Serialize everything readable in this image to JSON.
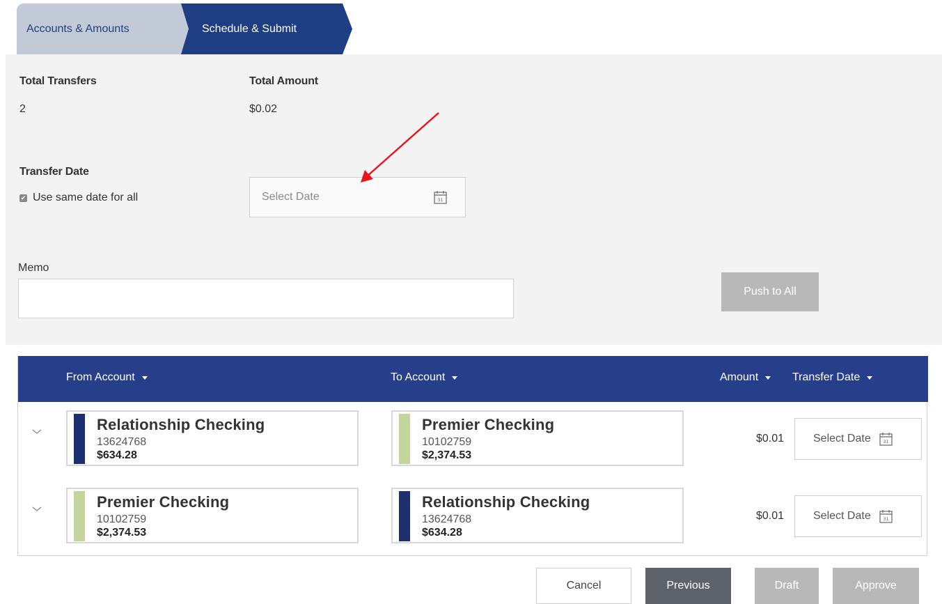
{
  "steps": [
    {
      "label": "Accounts & Amounts"
    },
    {
      "label": "Schedule & Submit"
    }
  ],
  "summary": {
    "total_transfers_label": "Total Transfers",
    "total_transfers_value": "2",
    "total_amount_label": "Total Amount",
    "total_amount_value": "$0.02",
    "transfer_date_label": "Transfer Date",
    "same_date_label": "Use same date for all",
    "same_date_checked": true,
    "date_placeholder": "Select Date",
    "memo_label": "Memo",
    "memo_value": "",
    "push_label": "Push to All"
  },
  "table": {
    "headers": {
      "from": "From Account",
      "to": "To Account",
      "amount": "Amount",
      "date": "Transfer Date"
    },
    "rows": [
      {
        "from": {
          "name": "Relationship Checking",
          "number": "13624768",
          "balance": "$634.28",
          "color": "#1c2f6e"
        },
        "to": {
          "name": "Premier Checking",
          "number": "10102759",
          "balance": "$2,374.53",
          "color": "#c3d59d"
        },
        "amount": "$0.01",
        "date_label": "Select Date"
      },
      {
        "from": {
          "name": "Premier Checking",
          "number": "10102759",
          "balance": "$2,374.53",
          "color": "#c3d59d"
        },
        "to": {
          "name": "Relationship Checking",
          "number": "13624768",
          "balance": "$634.28",
          "color": "#1c2f6e"
        },
        "amount": "$0.01",
        "date_label": "Select Date"
      }
    ]
  },
  "footer": {
    "cancel": "Cancel",
    "previous": "Previous",
    "draft": "Draft",
    "approve": "Approve"
  },
  "colors": {
    "header_blue": "#273f8a",
    "step_active": "#1e3d83",
    "step_inactive": "#c2cad8",
    "annotation_arrow": "#e8141a"
  },
  "icons": [
    "calendar-icon",
    "chevron-down-icon",
    "caret-down-icon",
    "checkbox-icon"
  ]
}
